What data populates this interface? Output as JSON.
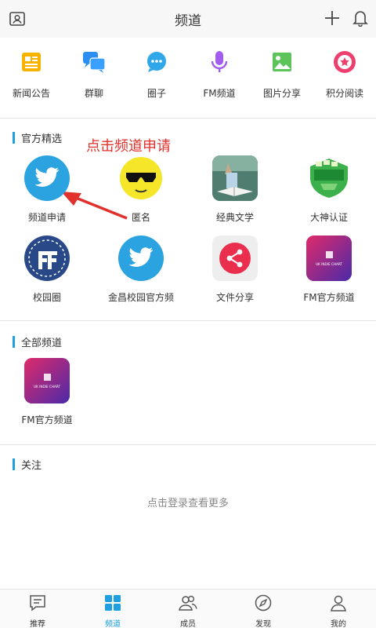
{
  "header": {
    "title": "频道"
  },
  "quick_links": [
    {
      "label": "新闻公告",
      "icon": "news-icon"
    },
    {
      "label": "群聊",
      "icon": "group-chat-icon"
    },
    {
      "label": "圈子",
      "icon": "circle-chat-icon"
    },
    {
      "label": "FM频道",
      "icon": "microphone-icon"
    },
    {
      "label": "图片分享",
      "icon": "image-icon"
    },
    {
      "label": "积分阅读",
      "icon": "star-badge-icon"
    }
  ],
  "sections": {
    "official": {
      "title": "官方精选"
    },
    "all": {
      "title": "全部频道"
    },
    "follow": {
      "title": "关注"
    }
  },
  "annotation": {
    "text": "点击频道申请",
    "color": "#e0312d"
  },
  "official_items": [
    {
      "label": "频道申请"
    },
    {
      "label": "匿名"
    },
    {
      "label": "经典文学"
    },
    {
      "label": "大神认证"
    },
    {
      "label": "校园圈"
    },
    {
      "label": "金昌校园官方频"
    },
    {
      "label": "文件分享"
    },
    {
      "label": "FM官方频道"
    }
  ],
  "all_items": [
    {
      "label": "FM官方频道"
    }
  ],
  "chart_text": {
    "uk_indie": "UK INDIE CHART"
  },
  "follow": {
    "login_more": "点击登录查看更多"
  },
  "tabs": [
    {
      "label": "推荐",
      "icon": "recommend-icon"
    },
    {
      "label": "频道",
      "icon": "channel-grid-icon"
    },
    {
      "label": "成员",
      "icon": "members-icon"
    },
    {
      "label": "发现",
      "icon": "compass-icon"
    },
    {
      "label": "我的",
      "icon": "profile-icon"
    }
  ],
  "colors": {
    "accent": "#1ea0e0",
    "annotation": "#e0312d"
  }
}
